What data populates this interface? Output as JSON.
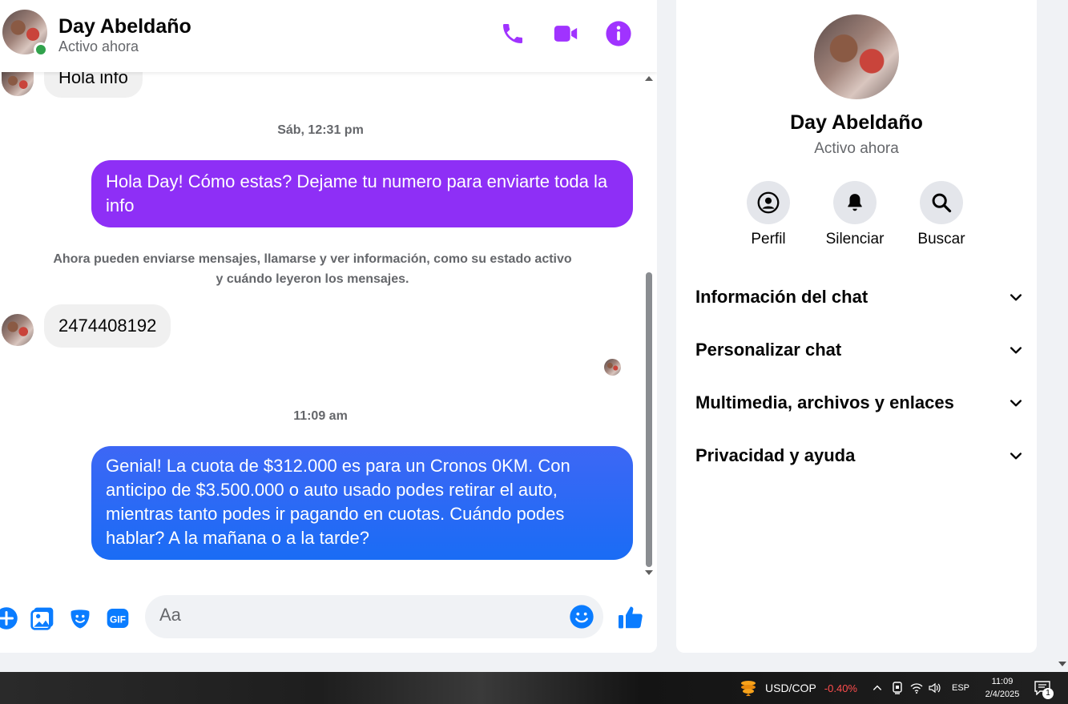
{
  "header": {
    "contact_name": "Day Abeldaño",
    "status": "Activo ahora"
  },
  "messages": {
    "first_incoming": "Hola info",
    "ts_1": "Sáb, 12:31 pm",
    "out_1": "Hola Day! Cómo estas? Dejame tu numero para enviarte toda la info",
    "system_note": "Ahora pueden enviarse mensajes, llamarse y ver información, como su estado activo y cuándo leyeron los mensajes.",
    "in_number": "2474408192",
    "ts_2": "11:09 am",
    "out_2": "Genial! La cuota de $312.000 es para un Cronos 0KM. Con anticipo de $3.500.000 o auto usado podes retirar el auto, mientras tanto podes ir pagando en cuotas. Cuándo podes hablar? A la mañana o a la tarde?"
  },
  "composer": {
    "placeholder": "Aa"
  },
  "info_panel": {
    "name": "Day Abeldaño",
    "status": "Activo ahora",
    "actions": [
      {
        "label": "Perfil",
        "icon": "profile-icon"
      },
      {
        "label": "Silenciar",
        "icon": "bell-icon"
      },
      {
        "label": "Buscar",
        "icon": "search-icon"
      }
    ],
    "sections": [
      {
        "label": "Información del chat"
      },
      {
        "label": "Personalizar chat"
      },
      {
        "label": "Multimedia, archivos y enlaces"
      },
      {
        "label": "Privacidad y ayuda"
      }
    ]
  },
  "taskbar": {
    "ticker_label": "USD/COP",
    "ticker_change": "-0.40%",
    "language": "ESP",
    "time": "11:09",
    "date": "2/4/2025",
    "notification_count": "1"
  },
  "colors": {
    "accent": "#a033ff",
    "purple_bubble": "#8e2ff6",
    "blue_bubble": "#1a6cf5",
    "online": "#31a24c",
    "negative": "#ff4d4d"
  }
}
